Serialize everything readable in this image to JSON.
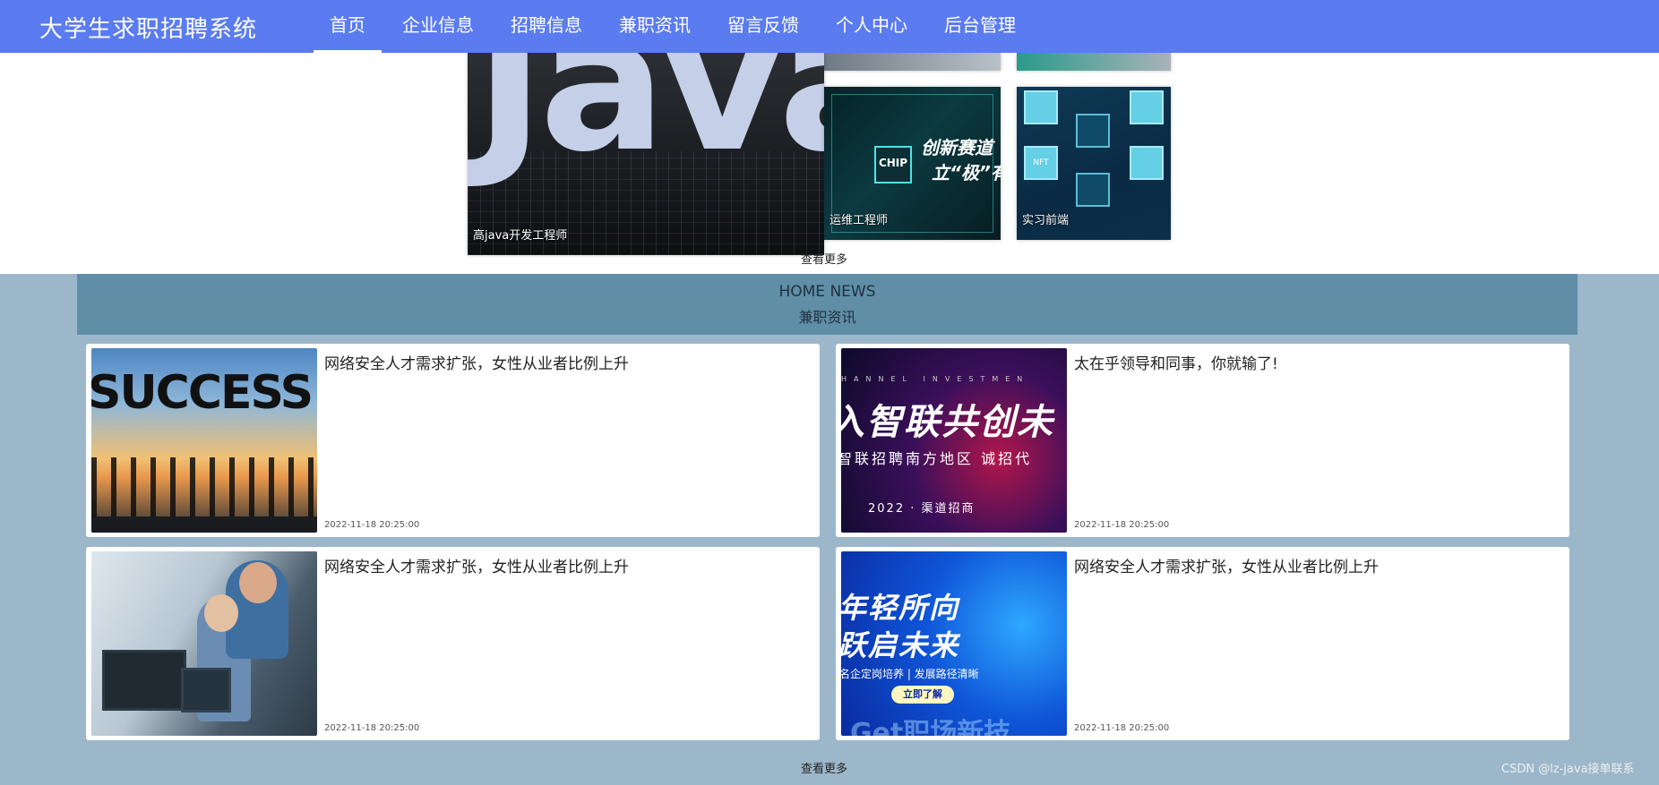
{
  "header": {
    "brand": "大学生求职招聘系统",
    "nav": [
      {
        "label": "首页",
        "active": true
      },
      {
        "label": "企业信息"
      },
      {
        "label": "招聘信息"
      },
      {
        "label": "兼职资讯"
      },
      {
        "label": "留言反馈"
      },
      {
        "label": "个人中心"
      },
      {
        "label": "后台管理"
      }
    ],
    "accent_color": "#5b7bf0"
  },
  "jobs": {
    "cards": [
      {
        "title": "高java开发工程师",
        "image_text": "Java"
      },
      {
        "title": "运维工程师",
        "image_text": [
          "CHIP",
          "创新赛道",
          "立“极”有你"
        ]
      },
      {
        "title": "实习前端",
        "image_text": "NFT"
      }
    ],
    "more": "查看更多"
  },
  "news": {
    "header_en": "HOME NEWS",
    "header_zh": "兼职资讯",
    "items": [
      {
        "title": "网络安全人才需求扩张，女性从业者比例上升",
        "date": "2022-11-18 20:25:00",
        "image_text": "SUCCESS"
      },
      {
        "title": "太在乎领导和同事，你就输了!",
        "date": "2022-11-18 20:25:00",
        "image_text": [
          "HANNEL INVESTMEN",
          "入智联共创未",
          "智联招聘南方地区 诚招代",
          "2022 · 渠道招商"
        ]
      },
      {
        "title": "网络安全人才需求扩张，女性从业者比例上升",
        "date": "2022-11-18 20:25:00"
      },
      {
        "title": "网络安全人才需求扩张，女性从业者比例上升",
        "date": "2022-11-18 20:25:00",
        "image_text": [
          "年轻所向",
          "跃启未来",
          "名企定岗培养 | 发展路径清晰",
          "立即了解",
          "Get职场新技"
        ]
      }
    ],
    "more": "查看更多"
  },
  "watermark": "CSDN @lz-java接单联系"
}
